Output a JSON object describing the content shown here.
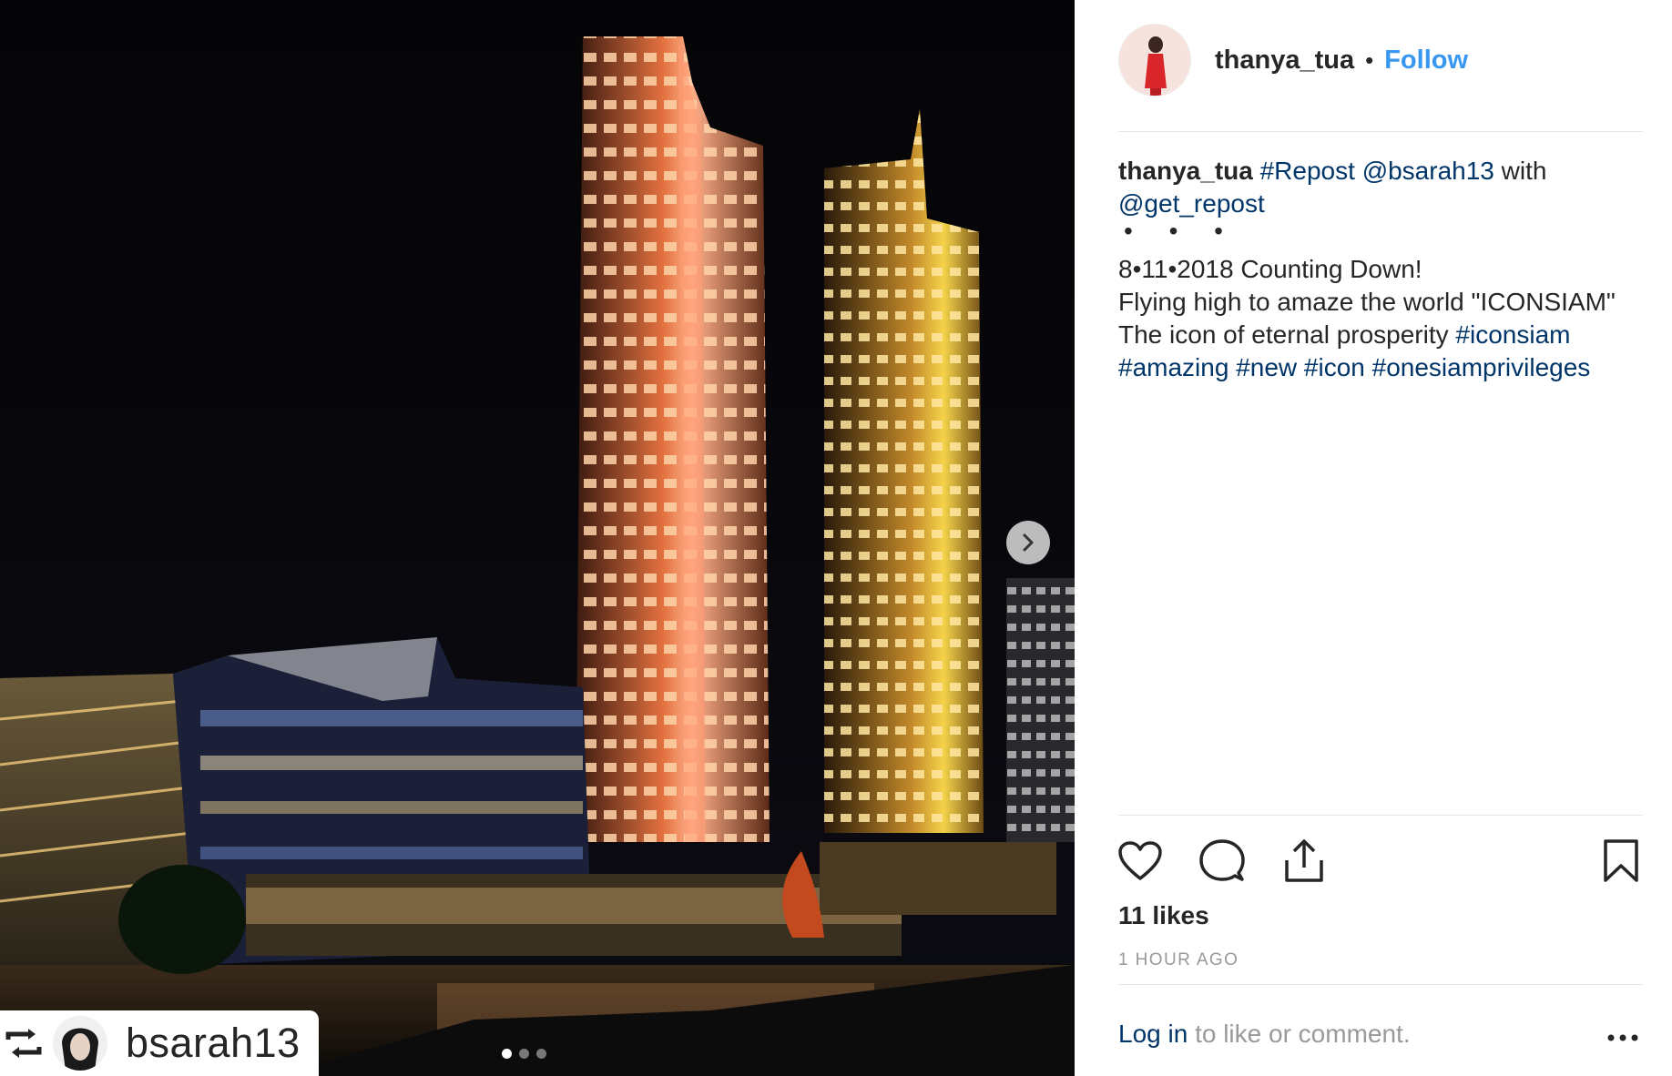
{
  "post": {
    "username": "thanya_tua",
    "bullet": "•",
    "follow_label": "Follow",
    "caption": {
      "username": "thanya_tua",
      "repost_tag": "#Repost",
      "mention": "@bsarah13",
      "with": "with",
      "source": "@get_repost",
      "dots": "• • •",
      "line1": "8•11•2018 Counting Down!",
      "line2": "Flying high to amaze the world \"ICONSIAM\"",
      "line3": "The icon of eternal prosperity",
      "tags": {
        "t1": "#iconsiam",
        "t2": "#amazing",
        "t3": "#new",
        "t4": "#icon",
        "t5": "#onesiamprivileges"
      }
    },
    "likes": "11 likes",
    "time": "1 HOUR AGO",
    "login_link": "Log in",
    "login_suffix": " to like or comment."
  },
  "photo": {
    "repost_username": "bsarah13",
    "carousel": {
      "count": 3,
      "active": 1
    },
    "icons": {
      "next": "chevron-right-icon",
      "repost": "repost-icon"
    }
  },
  "icons": {
    "like": "heart-icon",
    "comment": "comment-icon",
    "share": "share-icon",
    "save": "bookmark-icon",
    "more": "more-icon"
  },
  "colors": {
    "link": "#003569",
    "follow": "#3897f0",
    "text": "#262626",
    "muted": "#999999"
  }
}
